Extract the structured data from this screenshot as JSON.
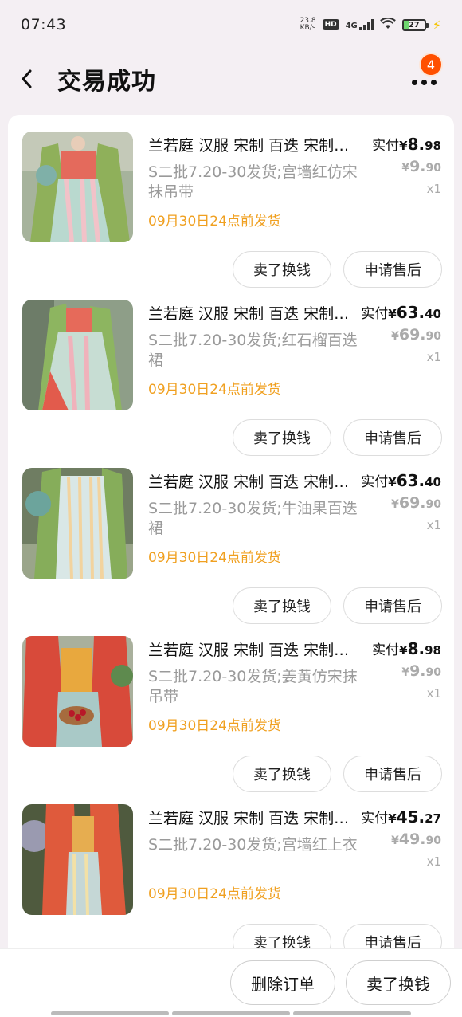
{
  "status_bar": {
    "time": "07:43",
    "net_speed_value": "23.8",
    "net_speed_unit": "KB/s",
    "hd": "HD",
    "network": "4G",
    "battery": "27",
    "battery_level": 0.27
  },
  "header": {
    "title": "交易成功",
    "notification_count": "4"
  },
  "items": [
    {
      "title": "兰若庭 汉服 宋制 百迭 宋制百迭裙",
      "sku": "S二批7.20-30发货;宫墙红仿宋抹吊带",
      "ship": "09月30日24点前发货",
      "paid_label": "实付",
      "currency": "¥",
      "paid_int": "8.",
      "paid_dec": "98",
      "orig_int": "9.",
      "orig_dec": "90",
      "qty": "x1",
      "btn_sell": "卖了换钱",
      "btn_after": "申请售后"
    },
    {
      "title": "兰若庭 汉服 宋制 百迭 宋制百迭裙",
      "sku": "S二批7.20-30发货;红石榴百迭裙",
      "ship": "09月30日24点前发货",
      "paid_label": "实付",
      "currency": "¥",
      "paid_int": "63.",
      "paid_dec": "40",
      "orig_int": "69.",
      "orig_dec": "90",
      "qty": "x1",
      "btn_sell": "卖了换钱",
      "btn_after": "申请售后"
    },
    {
      "title": "兰若庭 汉服 宋制 百迭 宋制百迭裙",
      "sku": "S二批7.20-30发货;牛油果百迭裙",
      "ship": "09月30日24点前发货",
      "paid_label": "实付",
      "currency": "¥",
      "paid_int": "63.",
      "paid_dec": "40",
      "orig_int": "69.",
      "orig_dec": "90",
      "qty": "x1",
      "btn_sell": "卖了换钱",
      "btn_after": "申请售后"
    },
    {
      "title": "兰若庭 汉服 宋制 百迭 宋制百迭裙",
      "sku": "S二批7.20-30发货;姜黄仿宋抹吊带",
      "ship": "09月30日24点前发货",
      "paid_label": "实付",
      "currency": "¥",
      "paid_int": "8.",
      "paid_dec": "98",
      "orig_int": "9.",
      "orig_dec": "90",
      "qty": "x1",
      "btn_sell": "卖了换钱",
      "btn_after": "申请售后"
    },
    {
      "title": "兰若庭 汉服 宋制 百迭 宋制百迭裙",
      "sku": "S二批7.20-30发货;宫墙红上衣",
      "ship": "09月30日24点前发货",
      "paid_label": "实付",
      "currency": "¥",
      "paid_int": "45.",
      "paid_dec": "27",
      "orig_int": "49.",
      "orig_dec": "90",
      "qty": "x1",
      "btn_sell": "卖了换钱",
      "btn_after": "申请售后"
    }
  ],
  "bottom_bar": {
    "delete_label": "删除订单",
    "sell_label": "卖了换钱"
  }
}
